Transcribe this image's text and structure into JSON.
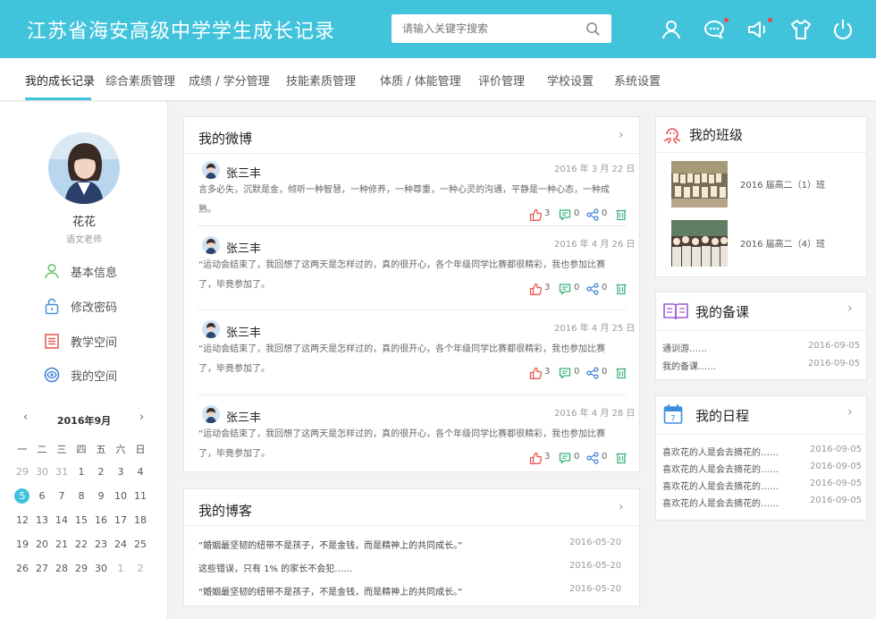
{
  "header": {
    "title": "江苏省海安高级中学学生成长记录",
    "search_placeholder": "请输入关键字搜索",
    "icons": [
      "user-icon",
      "message-icon",
      "announce-icon",
      "shirt-icon",
      "power-icon"
    ],
    "colors": {
      "brand": "#41c3dc",
      "alert_dot": "#f0434c"
    }
  },
  "nav": {
    "items": [
      {
        "label": "我的成长记录",
        "active": true
      },
      {
        "label": "综合素质管理"
      },
      {
        "label": "成绩 / 学分管理"
      },
      {
        "label": "技能素质管理"
      },
      {
        "label": "体质 / 体能管理"
      },
      {
        "label": "评价管理"
      },
      {
        "label": "学校设置"
      },
      {
        "label": "系统设置"
      }
    ]
  },
  "sidebar": {
    "name": "花花",
    "role": "语文老师",
    "menu": [
      {
        "label": "基本信息",
        "icon": "person-icon"
      },
      {
        "label": "修改密码",
        "icon": "lock-icon"
      },
      {
        "label": "教学空间",
        "icon": "document-icon"
      },
      {
        "label": "我的空间",
        "icon": "eye-icon"
      }
    ],
    "calendar": {
      "title": "2016年9月",
      "prev": "‹",
      "next": "›",
      "weekdays": [
        "一",
        "二",
        "三",
        "四",
        "五",
        "六",
        "日"
      ],
      "today": "5",
      "rows": [
        [
          "29",
          "30",
          "31",
          "1",
          "2",
          "3",
          "4"
        ],
        [
          "5",
          "6",
          "7",
          "8",
          "9",
          "10",
          "11"
        ],
        [
          "12",
          "13",
          "14",
          "15",
          "16",
          "17",
          "18"
        ],
        [
          "19",
          "20",
          "21",
          "22",
          "23",
          "24",
          "25"
        ],
        [
          "26",
          "27",
          "28",
          "29",
          "30",
          "1",
          "2"
        ]
      ]
    }
  },
  "weibo": {
    "title": "我的微博",
    "chevron": "›",
    "posts": [
      {
        "author": "张三丰",
        "date": "2016 年 3 月 22 日",
        "text": "言多必失，沉默是金，倾听一种智慧，一种修养，一种尊重，一种心灵的沟通，平静是一种心态，一种成熟。",
        "likes": "3",
        "comments": "0",
        "shares": "0"
      },
      {
        "author": "张三丰",
        "date": "2016 年 4 月 26 日",
        "text": "“运动会结束了，我回想了这两天是怎样过的，真的很开心，各个年级同学比赛都很精彩，我也参加比赛了，毕竟参加了。",
        "likes": "3",
        "comments": "0",
        "shares": "0"
      },
      {
        "author": "张三丰",
        "date": "2016 年 4 月 25 日",
        "text": "“运动会结束了，我回想了这两天是怎样过的，真的很开心，各个年级同学比赛都很精彩，我也参加比赛了，毕竟参加了。",
        "likes": "3",
        "comments": "0",
        "shares": "0"
      },
      {
        "author": "张三丰",
        "date": "2016 年 4 月 28 日",
        "text": "“运动会结束了，我回想了这两天是怎样过的，真的很开心，各个年级同学比赛都很精彩，我也参加比赛了，毕竟参加了。",
        "likes": "3",
        "comments": "0",
        "shares": "0"
      }
    ]
  },
  "blog": {
    "title": "我的博客",
    "chevron": "›",
    "items": [
      {
        "text": "“婚姻最坚韧的纽带不是孩子，不是金钱，而是精神上的共同成长。”",
        "date": "2016-05-20"
      },
      {
        "text": "这些错误，只有 1% 的家长不会犯……",
        "date": "2016-05-20"
      },
      {
        "text": "“婚姻最坚韧的纽带不是孩子，不是金钱，而是精神上的共同成长。”",
        "date": "2016-05-20"
      }
    ]
  },
  "my_class": {
    "title": "我的班级",
    "classes": [
      {
        "name": "2016 届高二（1）班"
      },
      {
        "name": "2016 届高二（4）班"
      }
    ]
  },
  "lessons": {
    "title": "我的备课",
    "chevron": "›",
    "items": [
      {
        "text": "通训游……",
        "date": "2016-09-05"
      },
      {
        "text": "我的备课……",
        "date": "2016-09-05"
      }
    ]
  },
  "schedule": {
    "title": "我的日程",
    "chevron": "›",
    "calendar_icon_day": "7",
    "items": [
      {
        "text": "喜欢花的人是会去摘花的……",
        "date": "2016-09-05"
      },
      {
        "text": "喜欢花的人是会去摘花的……",
        "date": "2016-09-05"
      },
      {
        "text": "喜欢花的人是会去摘花的……",
        "date": "2016-09-05"
      },
      {
        "text": "喜欢花的人是会去摘花的……",
        "date": "2016-09-05"
      }
    ]
  }
}
